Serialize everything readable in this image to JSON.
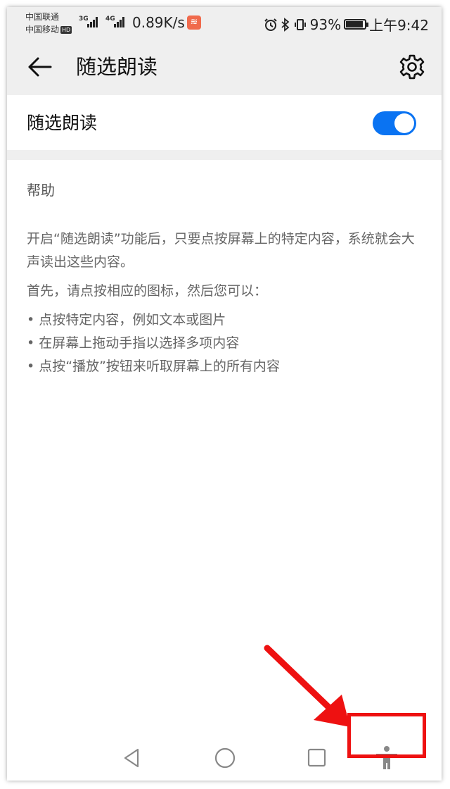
{
  "status_bar": {
    "carrier1": "中国联通",
    "carrier2": "中国移动",
    "hd_badge": "HD",
    "net_type1": "3G",
    "net_type2": "4G",
    "net_speed": "0.89K/s",
    "battery_percent": "93%",
    "battery_level": 0.93,
    "time": "上午9:42",
    "icons": [
      "alarm-icon",
      "bluetooth-icon",
      "vibrate-icon",
      "battery-icon",
      "wifi-hotspot-icon"
    ]
  },
  "app_bar": {
    "title": "随选朗读",
    "back_icon": "back-arrow-icon",
    "settings_icon": "gear-icon"
  },
  "toggle": {
    "label": "随选朗读",
    "state": "on",
    "accent_color": "#0a73f2"
  },
  "help": {
    "title": "帮助",
    "paragraph1": "开启“随选朗读”功能后，只要点按屏幕上的特定内容，系统就会大声读出这些内容。",
    "paragraph2": "首先，请点按相应的图标，然后您可以：",
    "bullets": [
      "点按特定内容，例如文本或图片",
      "在屏幕上拖动手指以选择多项内容",
      "点按“播放”按钮来听取屏幕上的所有内容"
    ]
  },
  "nav_bar": {
    "buttons": [
      "back-triangle-icon",
      "home-circle-icon",
      "recents-square-icon",
      "accessibility-icon"
    ],
    "highlight_color": "#ee1111"
  }
}
